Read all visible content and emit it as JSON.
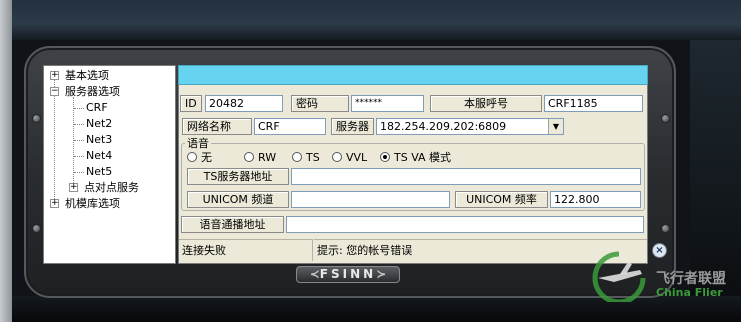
{
  "tree": {
    "items": [
      {
        "label": "基本选项",
        "expander": "+"
      },
      {
        "label": "服务器选项",
        "expander": "−"
      },
      {
        "label": "CRF"
      },
      {
        "label": "Net2"
      },
      {
        "label": "Net3"
      },
      {
        "label": "Net4"
      },
      {
        "label": "Net5"
      },
      {
        "label": "点对点服务",
        "expander": "+"
      },
      {
        "label": "机模库选项",
        "expander": "+"
      }
    ]
  },
  "form": {
    "id_label": "ID",
    "id_value": "20482",
    "password_label": "密码",
    "password_value": "******",
    "callsign_label": "本服呼号",
    "callsign_value": "CRF1185",
    "netname_label": "网络名称",
    "netname_value": "CRF",
    "server_label": "服务器",
    "server_value": "182.254.209.202:6809",
    "voice_group_title": "语音",
    "voice_options": [
      "无",
      "RW",
      "TS",
      "VVL",
      "TS VA 模式"
    ],
    "voice_selected": "TS VA 模式",
    "ts_server_label": "TS服务器地址",
    "ts_server_value": "",
    "unicom_channel_label": "UNICOM 频道",
    "unicom_channel_value": "",
    "unicom_freq_label": "UNICOM 频率",
    "unicom_freq_value": "122.800",
    "voice_broadcast_label": "语音通播地址",
    "voice_broadcast_value": ""
  },
  "status": {
    "connection": "连接失败",
    "hint": "提示: 您的帐号错误"
  },
  "brand": {
    "logo_text": "FSINN"
  },
  "watermark": {
    "cn": "飞行者联盟",
    "en": "China Flier"
  },
  "colors": {
    "cyan_bar": "#66d4f0",
    "panel": "#ece9d8",
    "watermark_green": "#3a9a3a"
  }
}
